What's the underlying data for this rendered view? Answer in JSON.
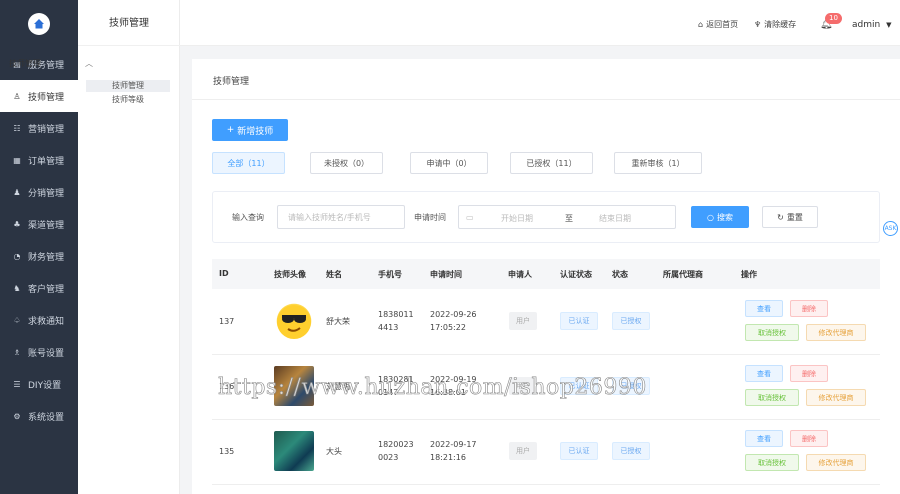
{
  "sidebar": {
    "items": [
      {
        "label": "服务管理",
        "icon": "service-icon",
        "glyph": "▤",
        "active": false
      },
      {
        "label": "技师管理",
        "icon": "user-icon",
        "glyph": "♙",
        "active": true
      },
      {
        "label": "营销管理",
        "icon": "marketing-icon",
        "glyph": "☷",
        "active": false
      },
      {
        "label": "订单管理",
        "icon": "order-icon",
        "glyph": "▦",
        "active": false
      },
      {
        "label": "分销管理",
        "icon": "distribution-icon",
        "glyph": "♟",
        "active": false
      },
      {
        "label": "渠道管理",
        "icon": "channel-icon",
        "glyph": "♣",
        "active": false
      },
      {
        "label": "财务管理",
        "icon": "finance-icon",
        "glyph": "◔",
        "active": false
      },
      {
        "label": "客户管理",
        "icon": "customer-icon",
        "glyph": "♞",
        "active": false
      },
      {
        "label": "求救通知",
        "icon": "bell-icon",
        "glyph": "♤",
        "active": false
      },
      {
        "label": "账号设置",
        "icon": "account-icon",
        "glyph": "♗",
        "active": false
      },
      {
        "label": "DIY设置",
        "icon": "diy-icon",
        "glyph": "☰",
        "active": false
      },
      {
        "label": "系统设置",
        "icon": "gear-icon",
        "glyph": "⚙",
        "active": false
      }
    ]
  },
  "subnav": {
    "title": "技师管理",
    "group": "技师管理",
    "items": [
      "技师管理",
      "技师等级"
    ]
  },
  "topbar": {
    "home": "返回首页",
    "clear_cache": "清除缓存",
    "badge": "10",
    "user": "admin"
  },
  "breadcrumb": "技师管理",
  "add_button": "新增技师",
  "tabs": [
    "全部（11）",
    "未授权（0）",
    "申请中（0）",
    "已授权（11）",
    "重新审核（1）"
  ],
  "filter": {
    "query_label": "输入查询",
    "query_placeholder": "请输入技师姓名/手机号",
    "time_label": "申请时间",
    "start_placeholder": "开始日期",
    "range_sep": "至",
    "end_placeholder": "结束日期",
    "search": "搜索",
    "reset": "重置"
  },
  "table": {
    "headers": [
      "ID",
      "技师头像",
      "姓名",
      "手机号",
      "申请时间",
      "申请人",
      "认证状态",
      "状态",
      "所属代理商",
      "操作"
    ],
    "rows": [
      {
        "id": "137",
        "name": "舒大荣",
        "phone1": "1838011",
        "phone2": "4413",
        "date": "2022-09-26",
        "time": "17:05:22",
        "applicant": "用户",
        "cert": "已认证",
        "status": "已授权",
        "agent": ""
      },
      {
        "id": "136",
        "name": "刘慧明",
        "phone1": "1830281",
        "phone2": "0147",
        "date": "2022-09-19",
        "time": "16:38:01",
        "applicant": "用户",
        "cert": "已认证",
        "status": "已授权",
        "agent": ""
      },
      {
        "id": "135",
        "name": "大头",
        "phone1": "1820023",
        "phone2": "0023",
        "date": "2022-09-17",
        "time": "18:21:16",
        "applicant": "用户",
        "cert": "已认证",
        "status": "已授权",
        "agent": ""
      }
    ],
    "ops": {
      "view": "查看",
      "delete": "删除",
      "revoke": "取消授权",
      "change_agent": "修改代理商"
    }
  },
  "watermark": "https://www.huzhan.com/ishop26990",
  "colors": {
    "primary": "#409eff",
    "sidebar": "#2b3443",
    "danger": "#f56c6c",
    "success": "#67c23a",
    "warning": "#e6a23c"
  }
}
